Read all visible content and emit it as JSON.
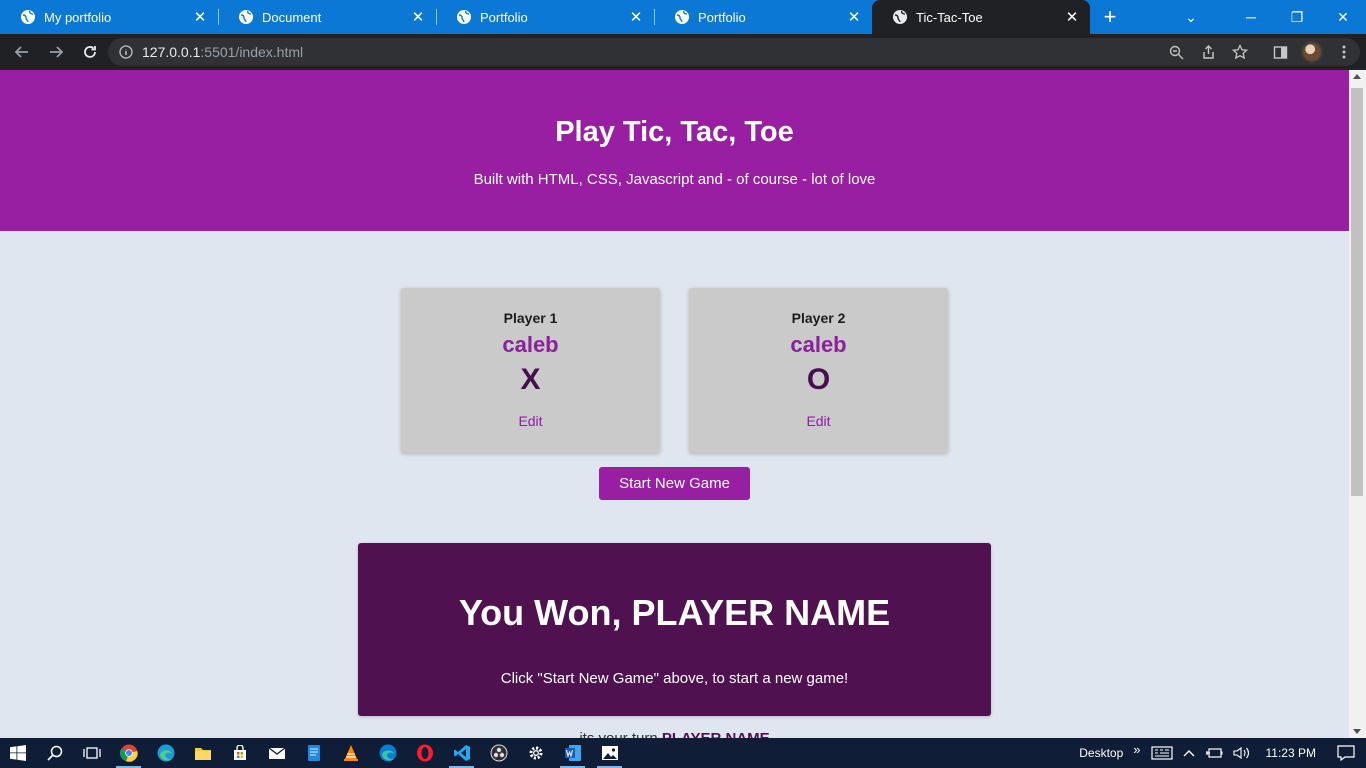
{
  "browser": {
    "tabs": [
      {
        "title": "My portfolio",
        "active": false
      },
      {
        "title": "Document",
        "active": false
      },
      {
        "title": "Portfolio",
        "active": false
      },
      {
        "title": "Portfolio",
        "active": false
      },
      {
        "title": "Tic-Tac-Toe",
        "active": true
      }
    ],
    "url_host": "127.0.0.1",
    "url_path": ":5501/index.html"
  },
  "page": {
    "title": "Play Tic, Tac, Toe",
    "subtitle": "Built with HTML, CSS, Javascript and - of course - lot of love",
    "players": [
      {
        "label": "Player 1",
        "name": "caleb",
        "symbol": "X",
        "edit_label": "Edit"
      },
      {
        "label": "Player 2",
        "name": "caleb",
        "symbol": "O",
        "edit_label": "Edit"
      }
    ],
    "start_button": "Start New Game",
    "game_over": {
      "title": "You Won, PLAYER NAME",
      "message": "Click \"Start New Game\" above, to start a new game!"
    },
    "turn": {
      "prefix": "its your turn ",
      "player": "PLAYER NAME"
    }
  },
  "colors": {
    "brand": "#981ea2",
    "dark_brand": "#4f1150",
    "page_bg": "#dfe6ef",
    "card_bg": "#cacaca"
  },
  "taskbar": {
    "desktop_label": "Desktop",
    "time": "11:23 PM",
    "apps": [
      "start-icon",
      "search-icon",
      "task-view-icon",
      "chrome-icon",
      "edge-icon",
      "file-explorer-icon",
      "store-icon",
      "mail-icon",
      "file-icon",
      "vlc-icon",
      "edge-beta-icon",
      "opera-icon",
      "vscode-icon",
      "obs-icon",
      "settings-icon",
      "word-icon",
      "photos-icon"
    ]
  }
}
